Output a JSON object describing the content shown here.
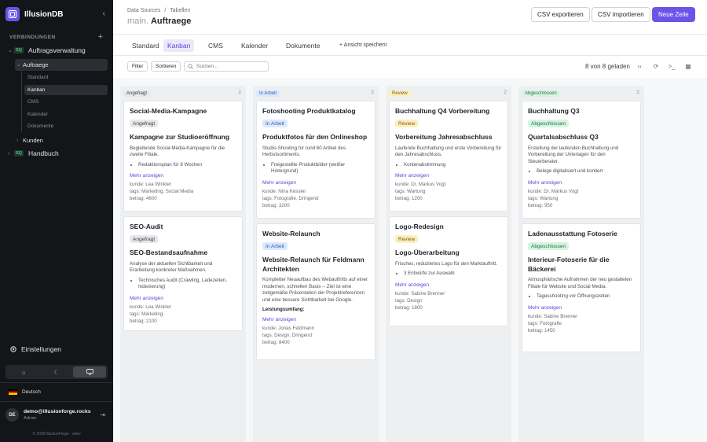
{
  "app": {
    "name": "IllusionDB"
  },
  "sidebar": {
    "section_label": "VERBINDUNGEN",
    "connections": [
      {
        "badge": "SQ",
        "label": "Auftragsverwaltung"
      },
      {
        "badge": "SQ",
        "label": "Handbuch"
      }
    ],
    "table": "Auftraege",
    "views": [
      "Standard",
      "Kanban",
      "CMS",
      "Kalender",
      "Dokumente"
    ],
    "other_table": "Kunden",
    "settings": "Einstellungen",
    "language": "Deutsch",
    "user": {
      "initials": "DE",
      "email": "demo@illusionforge.rocks",
      "role": "Admin"
    },
    "copyright": "© 2026 IllusionForge · vdev"
  },
  "header": {
    "breadcrumb": [
      "Data Sources",
      "Tabellen"
    ],
    "breadcrumb_sep": "/",
    "title_prefix": "main.",
    "title": "Auftraege",
    "buttons": {
      "export": "CSV exportieren",
      "import": "CSV importieren",
      "new_row": "Neue Zeile"
    }
  },
  "tabs": [
    "Standard",
    "Kanban",
    "CMS",
    "Kalender",
    "Dokumente"
  ],
  "save_view": "+ Ansicht speichern",
  "controls": {
    "filter": "Filter",
    "sort": "Sortieren",
    "search_placeholder": "Suchen...",
    "loaded": "8 von 8 geladen"
  },
  "more_label": "Mehr anzeigen",
  "columns": [
    {
      "status": "Angefragt",
      "count": "2",
      "cards": [
        {
          "title": "Social-Media-Kampagne",
          "badge": "Angefragt",
          "h2": "Kampagne zur Studioeröffnung",
          "desc": "Begleitende Social-Media-Kampagne für die zweite Filiale.",
          "list": [
            "Redaktionsplan für 6 Wochen"
          ],
          "meta": [
            "kunde: Lea Winkler",
            "tags: Marketing, Social Media",
            "betrag: 4600"
          ]
        },
        {
          "title": "SEO-Audit",
          "badge": "Angefragt",
          "h2": "SEO-Bestandsaufnahme",
          "desc": "Analyse der aktuellen Sichtbarkeit und Erarbeitung konkreter Maßnahmen.",
          "list": [
            "Technisches Audit (Crawling, Ladezeiten, Indexierung)"
          ],
          "meta": [
            "kunde: Lea Winkler",
            "tags: Marketing",
            "betrag: 2100"
          ]
        }
      ]
    },
    {
      "status": "In Arbeit",
      "count": "2",
      "cards": [
        {
          "title": "Fotoshooting Produktkatalog",
          "badge": "In Arbeit",
          "h2": "Produktfotos für den Onlineshop",
          "desc": "Studio-Shooting für rund 60 Artikel des Herbstsortiments.",
          "list": [
            "Freigestellte Produktbilder (weißer Hintergrund)"
          ],
          "meta": [
            "kunde: Nina Kessler",
            "tags: Fotografie, Dringend",
            "betrag: 3200"
          ]
        },
        {
          "title": "Website-Relaunch",
          "badge": "In Arbeit",
          "h2": "Website-Relaunch für Feldmann Architekten",
          "desc": "Kompletter Neuaufbau des Webauftritts auf einer modernen, schnellen Basis -- Ziel ist eine zeitgemäße Präsentation der Projektreferenzen und eine bessere Sichtbarkeit bei Google.",
          "sub": "Leistungsumfang:",
          "meta": [
            "kunde: Jonas Feldmann",
            "tags: Design, Dringend",
            "betrag: 8400"
          ]
        }
      ]
    },
    {
      "status": "Review",
      "count": "2",
      "cards": [
        {
          "title": "Buchhaltung Q4 Vorbereitung",
          "badge": "Review",
          "h2": "Vorbereitung Jahresabschluss",
          "desc": "Laufende Buchhaltung und erste Vorbereitung für den Jahresabschluss.",
          "list": [
            "Kontenabstimmung"
          ],
          "meta": [
            "kunde: Dr. Markus Vogt",
            "tags: Wartung",
            "betrag: 1200"
          ]
        },
        {
          "title": "Logo-Redesign",
          "badge": "Review",
          "h2": "Logo-Überarbeitung",
          "desc": "Frisches, reduziertes Logo für den Marktauftritt.",
          "list": [
            "3 Entwürfe zur Auswahl"
          ],
          "meta": [
            "kunde: Sabine Brenner",
            "tags: Design",
            "betrag: 1800"
          ]
        }
      ]
    },
    {
      "status": "Abgeschlossen",
      "count": "2",
      "cards": [
        {
          "title": "Buchhaltung Q3",
          "badge": "Abgeschlossen",
          "h2": "Quartalsabschluss Q3",
          "desc": "Erstellung der laufenden Buchhaltung und Vorbereitung der Unterlagen für den Steuerberater.",
          "list": [
            "Belege digitalisiert und kontiert"
          ],
          "meta": [
            "kunde: Dr. Markus Vogt",
            "tags: Wartung",
            "betrag: 950"
          ]
        },
        {
          "title": "Ladenausstattung Fotoserie",
          "badge": "Abgeschlossen",
          "h2": "Interieur-Fotoserie für die Bäckerei",
          "desc": "Atmosphärische Aufnahmen der neu gestalteten Filiale für Website und Social Media.",
          "list": [
            "Tagesshooting vor Öffnungszeiten"
          ],
          "meta": [
            "kunde: Sabine Brenner",
            "tags: Fotografie",
            "betrag: 1450"
          ]
        }
      ]
    }
  ]
}
